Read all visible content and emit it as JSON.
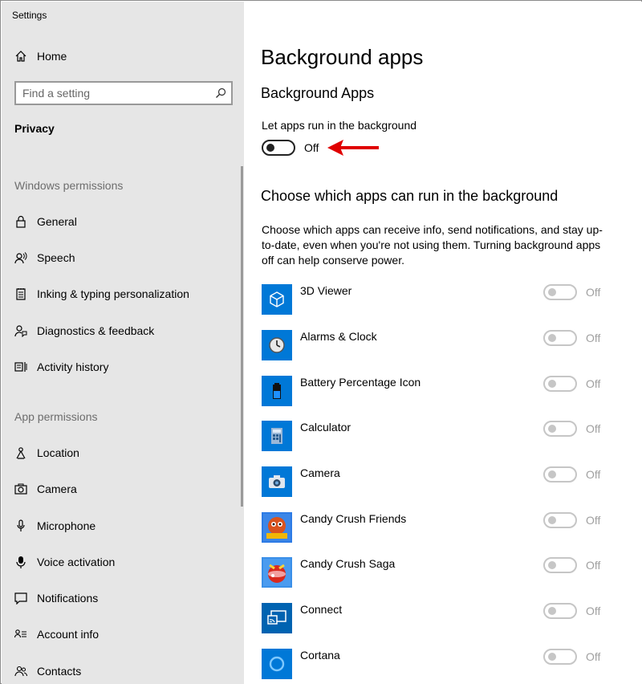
{
  "window": {
    "title": "Settings"
  },
  "sidebar": {
    "home_label": "Home",
    "search_placeholder": "Find a setting",
    "category": "Privacy",
    "windows_permissions_header": "Windows permissions",
    "windows_permissions": [
      {
        "label": "General",
        "icon": "lock-icon"
      },
      {
        "label": "Speech",
        "icon": "speech-icon"
      },
      {
        "label": "Inking & typing personalization",
        "icon": "notepad-icon"
      },
      {
        "label": "Diagnostics & feedback",
        "icon": "diagnostics-icon"
      },
      {
        "label": "Activity history",
        "icon": "activity-history-icon"
      }
    ],
    "app_permissions_header": "App permissions",
    "app_permissions": [
      {
        "label": "Location",
        "icon": "location-icon"
      },
      {
        "label": "Camera",
        "icon": "camera-icon"
      },
      {
        "label": "Microphone",
        "icon": "microphone-icon"
      },
      {
        "label": "Voice activation",
        "icon": "voice-activation-icon"
      },
      {
        "label": "Notifications",
        "icon": "notifications-icon"
      },
      {
        "label": "Account info",
        "icon": "account-info-icon"
      },
      {
        "label": "Contacts",
        "icon": "contacts-icon"
      }
    ]
  },
  "main": {
    "page_title": "Background apps",
    "section_title": "Background Apps",
    "toggle_label": "Let apps run in the background",
    "toggle_state": "Off",
    "choose_title": "Choose which apps can run in the background",
    "description": "Choose which apps can receive info, send notifications, and stay up-to-date, even when you're not using them. Turning background apps off can help conserve power.",
    "apps": [
      {
        "name": "3D Viewer",
        "state": "Off",
        "icon": "cube-icon"
      },
      {
        "name": "Alarms & Clock",
        "state": "Off",
        "icon": "clock-icon"
      },
      {
        "name": "Battery Percentage Icon",
        "state": "Off",
        "icon": "battery-icon"
      },
      {
        "name": "Calculator",
        "state": "Off",
        "icon": "calculator-icon"
      },
      {
        "name": "Camera",
        "state": "Off",
        "icon": "camera-app-icon"
      },
      {
        "name": "Candy Crush Friends",
        "state": "Off",
        "icon": "candy-crush-friends-icon"
      },
      {
        "name": "Candy Crush Saga",
        "state": "Off",
        "icon": "candy-crush-saga-icon"
      },
      {
        "name": "Connect",
        "state": "Off",
        "icon": "connect-icon"
      },
      {
        "name": "Cortana",
        "state": "Off",
        "icon": "cortana-icon"
      }
    ]
  },
  "colors": {
    "accent": "#0078d7",
    "sidebar_bg": "#e6e6e6",
    "annotation_arrow": "#e00000",
    "disabled": "#c6c6c6"
  }
}
